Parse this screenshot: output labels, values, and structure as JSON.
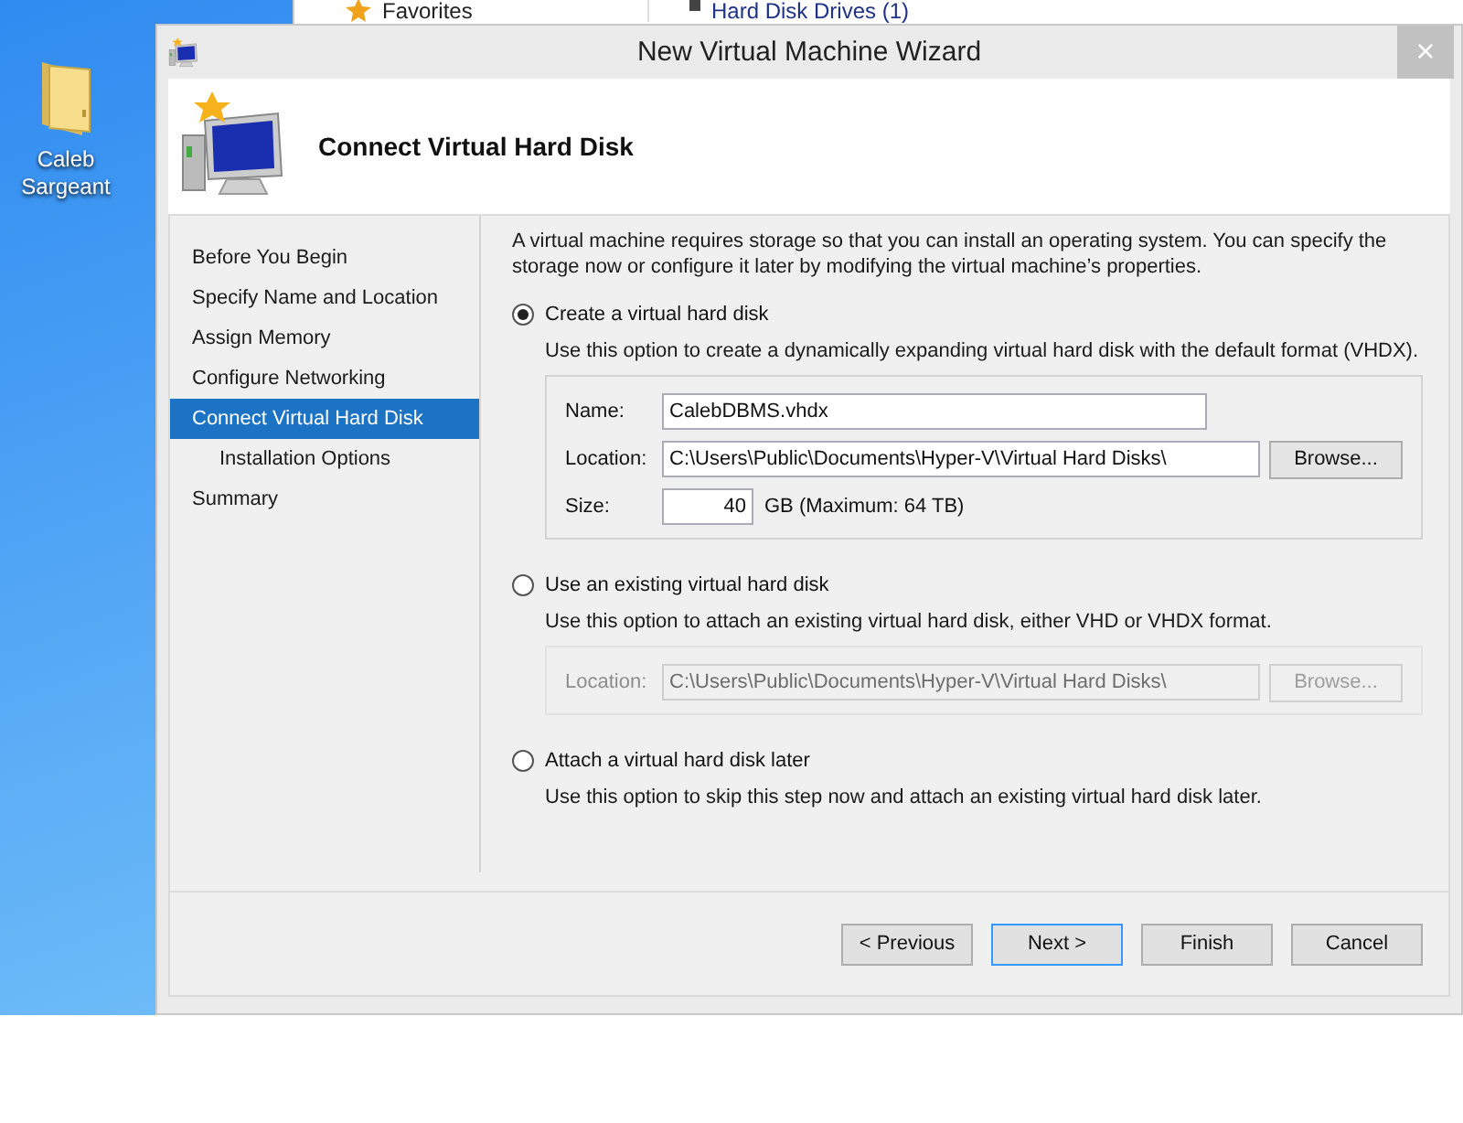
{
  "desktop": {
    "icons": [
      {
        "label": "Caleb Sargeant"
      }
    ]
  },
  "background_window": {
    "nav_item": "Favorites",
    "section": "Hard Disk Drives (1)"
  },
  "window": {
    "title": "New Virtual Machine Wizard",
    "close": "×",
    "heading": "Connect Virtual Hard Disk"
  },
  "steps": [
    {
      "label": "Before You Begin",
      "selected": false
    },
    {
      "label": "Specify Name and Location",
      "selected": false
    },
    {
      "label": "Assign Memory",
      "selected": false
    },
    {
      "label": "Configure Networking",
      "selected": false
    },
    {
      "label": "Connect Virtual Hard Disk",
      "selected": true,
      "children": [
        {
          "label": "Installation Options",
          "selected": false
        }
      ]
    },
    {
      "label": "Summary",
      "selected": false
    }
  ],
  "intro": "A virtual machine requires storage so that you can install an operating system. You can specify the storage now or configure it later by modifying the virtual machine’s properties.",
  "options": [
    {
      "label": "Create a virtual hard disk",
      "selected": true,
      "description": "Use this option to create a dynamically expanding virtual hard disk with the default format (VHDX).",
      "fields": [
        {
          "kind": "text",
          "label": "Name:",
          "value": "CalebDBMS.vhdx"
        },
        {
          "kind": "path",
          "label": "Location:",
          "value": "C:\\Users\\Public\\Documents\\Hyper-V\\Virtual Hard Disks\\",
          "button": "Browse..."
        },
        {
          "kind": "number",
          "label": "Size:",
          "value": "40",
          "unit": "GB (Maximum: 64 TB)"
        }
      ]
    },
    {
      "label": "Use an existing virtual hard disk",
      "selected": false,
      "description": "Use this option to attach an existing virtual hard disk, either VHD or VHDX format.",
      "disabled": true,
      "fields": [
        {
          "kind": "path",
          "label": "Location:",
          "value": "C:\\Users\\Public\\Documents\\Hyper-V\\Virtual Hard Disks\\",
          "button": "Browse..."
        }
      ]
    },
    {
      "label": "Attach a virtual hard disk later",
      "selected": false,
      "description": "Use this option to skip this step now and attach an existing virtual hard disk later."
    }
  ],
  "buttons": [
    {
      "label": "< Previous",
      "focused": false
    },
    {
      "label": "Next >",
      "focused": true
    },
    {
      "label": "Finish",
      "focused": false
    },
    {
      "label": "Cancel",
      "focused": false
    }
  ]
}
